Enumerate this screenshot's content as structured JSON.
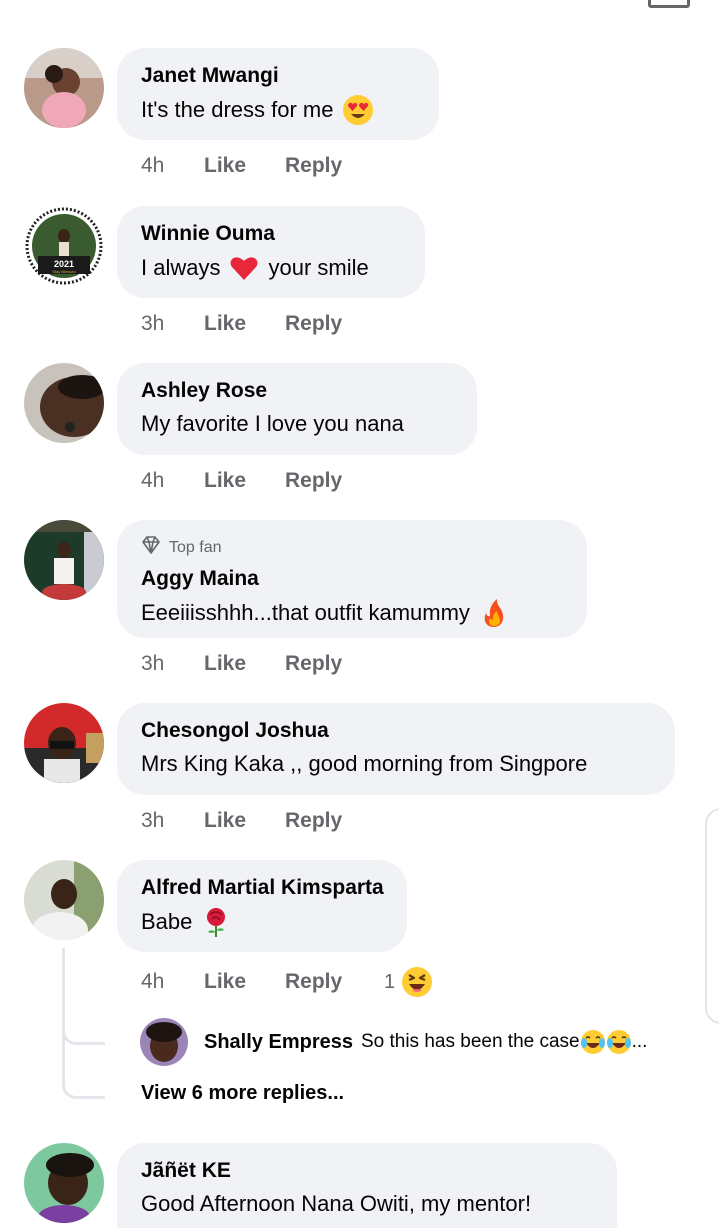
{
  "comments": [
    {
      "name": "Janet Mwangi",
      "text": "It's the dress for me",
      "emoji": "heart-eyes",
      "time": "4h",
      "like": "Like",
      "reply": "Reply"
    },
    {
      "name": "Winnie Ouma",
      "text_before": "I always",
      "text_after": "your smile",
      "emoji": "red-heart",
      "time": "3h",
      "like": "Like",
      "reply": "Reply",
      "avatar_text_year": "2021",
      "avatar_text_sub": "Stay Blessed"
    },
    {
      "name": "Ashley Rose",
      "text": "My favorite I love you nana",
      "time": "4h",
      "like": "Like",
      "reply": "Reply"
    },
    {
      "badge": "Top fan",
      "name": "Aggy Maina",
      "text": "Eeeiiisshhh...that outfit kamummy",
      "emoji": "fire",
      "time": "3h",
      "like": "Like",
      "reply": "Reply"
    },
    {
      "name": "Chesongol Joshua",
      "text": "Mrs King Kaka ,, good morning from Singpore",
      "time": "3h",
      "like": "Like",
      "reply": "Reply"
    },
    {
      "name": "Alfred Martial Kimsparta",
      "text": "Babe",
      "emoji": "rose",
      "time": "4h",
      "like": "Like",
      "reply": "Reply",
      "reaction_count": "1",
      "reaction": "laughing"
    },
    {
      "name": "Jãñët KE",
      "text": "Good Afternoon Nana Owiti, my mentor!"
    }
  ],
  "reply_preview": {
    "name": "Shally Empress",
    "text": "So this has been the case",
    "emoji": "tears-of-joy",
    "ellipsis": "..."
  },
  "view_more": "View 6 more replies...",
  "colors": {
    "bubble": "#f0f2f5",
    "secondary_text": "#65676b",
    "primary_text": "#050505",
    "thread_line": "#e4e6eb"
  }
}
